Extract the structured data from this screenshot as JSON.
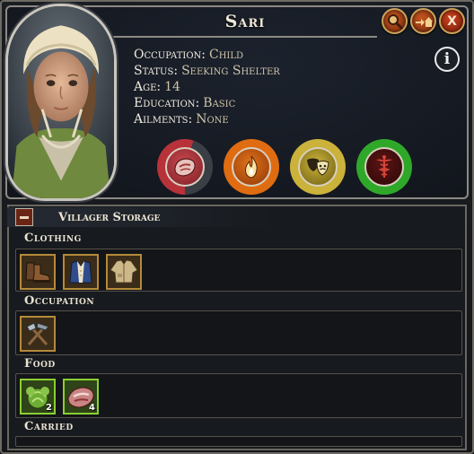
{
  "villager": {
    "name": "Sari",
    "occupation_label": "Occupation:",
    "occupation": "Child",
    "status_label": "Status:",
    "status": "Seeking Shelter",
    "age_label": "Age:",
    "age": "14",
    "education_label": "Education:",
    "education": "Basic",
    "ailments_label": "Ailments:",
    "ailments": "None"
  },
  "header_buttons": {
    "zoom_icon": "magnifier-icon",
    "home_icon": "go-home-icon",
    "close_label": "X",
    "info_label": "i"
  },
  "needs": [
    {
      "name": "food",
      "icon": "meat-icon",
      "fill_fraction": 0.55,
      "color": "#b8323a"
    },
    {
      "name": "warmth",
      "icon": "flame-icon",
      "fill_fraction": 1.0,
      "color": "#e06c12"
    },
    {
      "name": "happiness",
      "icon": "theater-masks-icon",
      "fill_fraction": 1.0,
      "color": "#cbb23a"
    },
    {
      "name": "health",
      "icon": "caduceus-icon",
      "fill_fraction": 1.0,
      "color": "#2fa82a"
    }
  ],
  "storage": {
    "title": "Villager Storage",
    "sections": [
      {
        "label": "Clothing",
        "items": [
          {
            "icon": "boots-icon",
            "count": ""
          },
          {
            "icon": "vest-icon",
            "count": ""
          },
          {
            "icon": "coat-icon",
            "count": ""
          }
        ]
      },
      {
        "label": "Occupation",
        "items": [
          {
            "icon": "hammer-axe-tools-icon",
            "count": ""
          }
        ]
      },
      {
        "label": "Food",
        "items": [
          {
            "icon": "cabbage-icon",
            "count": "2"
          },
          {
            "icon": "meat-icon",
            "count": "4"
          }
        ]
      },
      {
        "label": "Carried",
        "items": []
      }
    ]
  },
  "colors": {
    "slot_border": "#b58a3a",
    "food_slot_border": "#8bcf32",
    "close_button": "#c8401c"
  }
}
